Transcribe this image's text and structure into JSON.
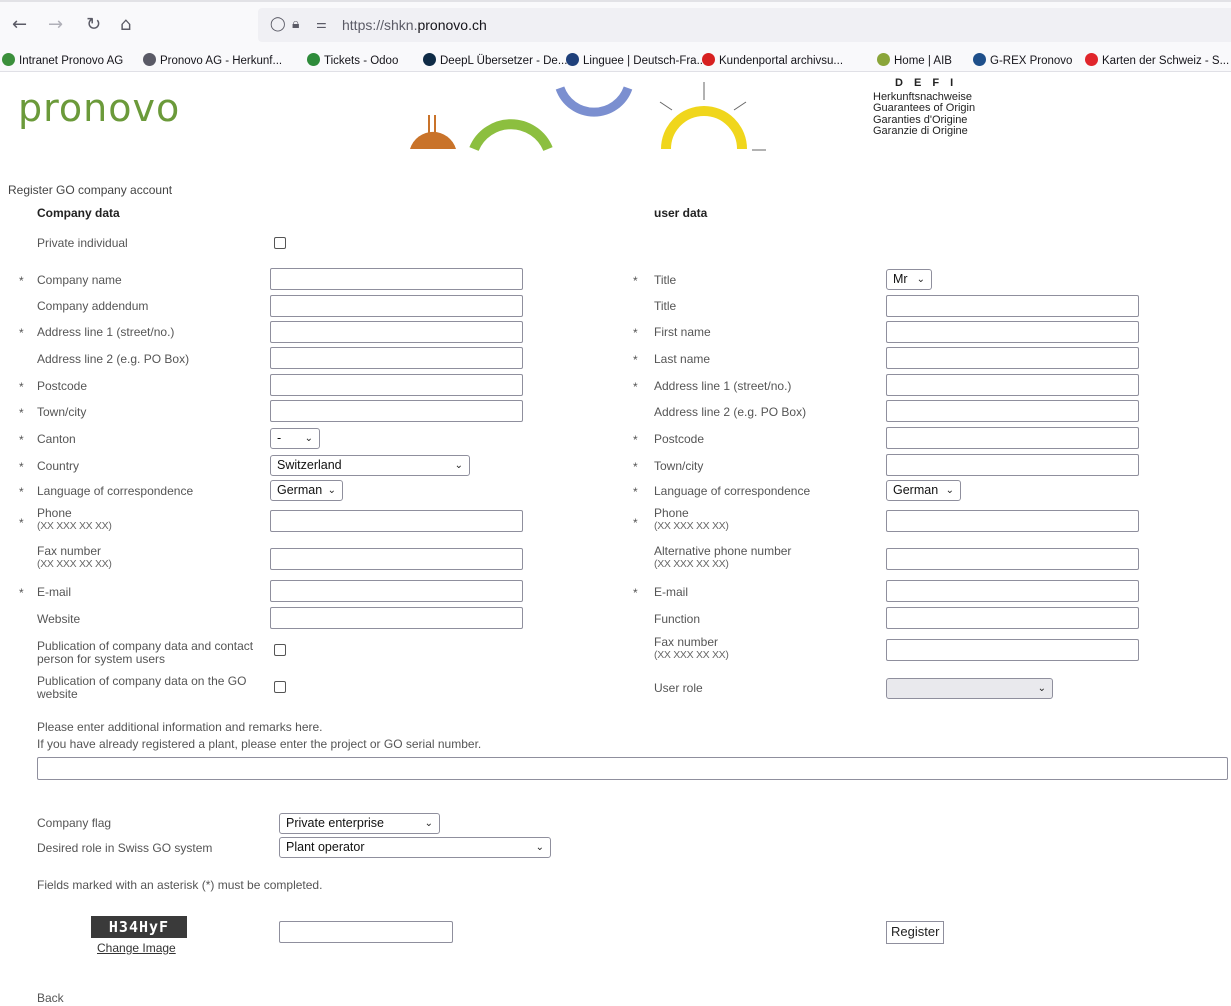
{
  "browser": {
    "url_prefix": "https://shkn.",
    "url_domain": "pronovo.ch",
    "bookmarks": [
      {
        "label": "Intranet Pronovo AG",
        "color": "#3b8f3b"
      },
      {
        "label": "Pronovo AG - Herkunf...",
        "color": "#5a5a66"
      },
      {
        "label": "Tickets - Odoo",
        "color": "#2e8b3a"
      },
      {
        "label": "DeepL Übersetzer - De...",
        "color": "#0f2b46"
      },
      {
        "label": "Linguee | Deutsch-Fra...",
        "color": "#1e3f7a"
      },
      {
        "label": "Kundenportal archivsu...",
        "color": "#d72020"
      },
      {
        "label": "Home | AIB",
        "color": "#8aa53a"
      },
      {
        "label": "G-REX Pronovo",
        "color": "#1e4f8a"
      },
      {
        "label": "Karten der Schweiz - S...",
        "color": "#e0252b"
      }
    ]
  },
  "header": {
    "logo": "pronovo",
    "defi_letters": "D E F I",
    "lines": [
      "Herkunftsnachweise",
      "Guarantees of Origin",
      "Garanties d'Origine",
      "Garanzie di Origine"
    ]
  },
  "page_title": "Register GO company account",
  "company": {
    "heading": "Company data",
    "private_individual": "Private individual",
    "company_name": "Company name",
    "company_addendum": "Company addendum",
    "address1": "Address line 1 (street/no.)",
    "address2": "Address line 2 (e.g. PO Box)",
    "postcode": "Postcode",
    "town": "Town/city",
    "canton": "Canton",
    "canton_value": "-",
    "country": "Country",
    "country_value": "Switzerland",
    "language": "Language of correspondence",
    "language_value": "German",
    "phone": "Phone",
    "phone_hint": "(XX XXX XX XX)",
    "fax": "Fax number",
    "fax_hint": "(XX XXX XX XX)",
    "email": "E-mail",
    "website": "Website",
    "pub_contact": "Publication of company data and contact person for system users",
    "pub_website": "Publication of company data on the GO website"
  },
  "user": {
    "heading": "user data",
    "title_select": "Title",
    "title_value": "Mr",
    "title_text": "Title",
    "first_name": "First name",
    "last_name": "Last name",
    "address1": "Address line 1 (street/no.)",
    "address2": "Address line 2 (e.g. PO Box)",
    "postcode": "Postcode",
    "town": "Town/city",
    "language": "Language of correspondence",
    "language_value": "German",
    "phone": "Phone",
    "phone_hint": "(XX XXX XX XX)",
    "alt_phone": "Alternative phone number",
    "alt_phone_hint": "(XX XXX XX XX)",
    "email": "E-mail",
    "function": "Function",
    "fax": "Fax number",
    "fax_hint": "(XX XXX XX XX)",
    "user_role": "User role",
    "user_role_value": ""
  },
  "remarks": {
    "line1": "Please enter additional information and remarks here.",
    "line2": "If you have already registered a plant, please enter the project or GO serial number."
  },
  "flags": {
    "company_flag": "Company flag",
    "company_flag_value": "Private enterprise",
    "desired_role": "Desired role in Swiss GO system",
    "desired_role_value": "Plant operator"
  },
  "required_note": "Fields marked with an asterisk (*) must be completed.",
  "captcha": {
    "text": "H34HyF",
    "change_image": "Change Image"
  },
  "register_button": "Register",
  "back_link": "Back",
  "asterisk": "*",
  "chevron": "⌄",
  "colors": {
    "brand_green": "#6b9a3a",
    "banner_orange": "#c9732a",
    "banner_green": "#8cbf3f",
    "banner_blue": "#7b8fd0",
    "banner_yellow": "#f0d61c"
  }
}
